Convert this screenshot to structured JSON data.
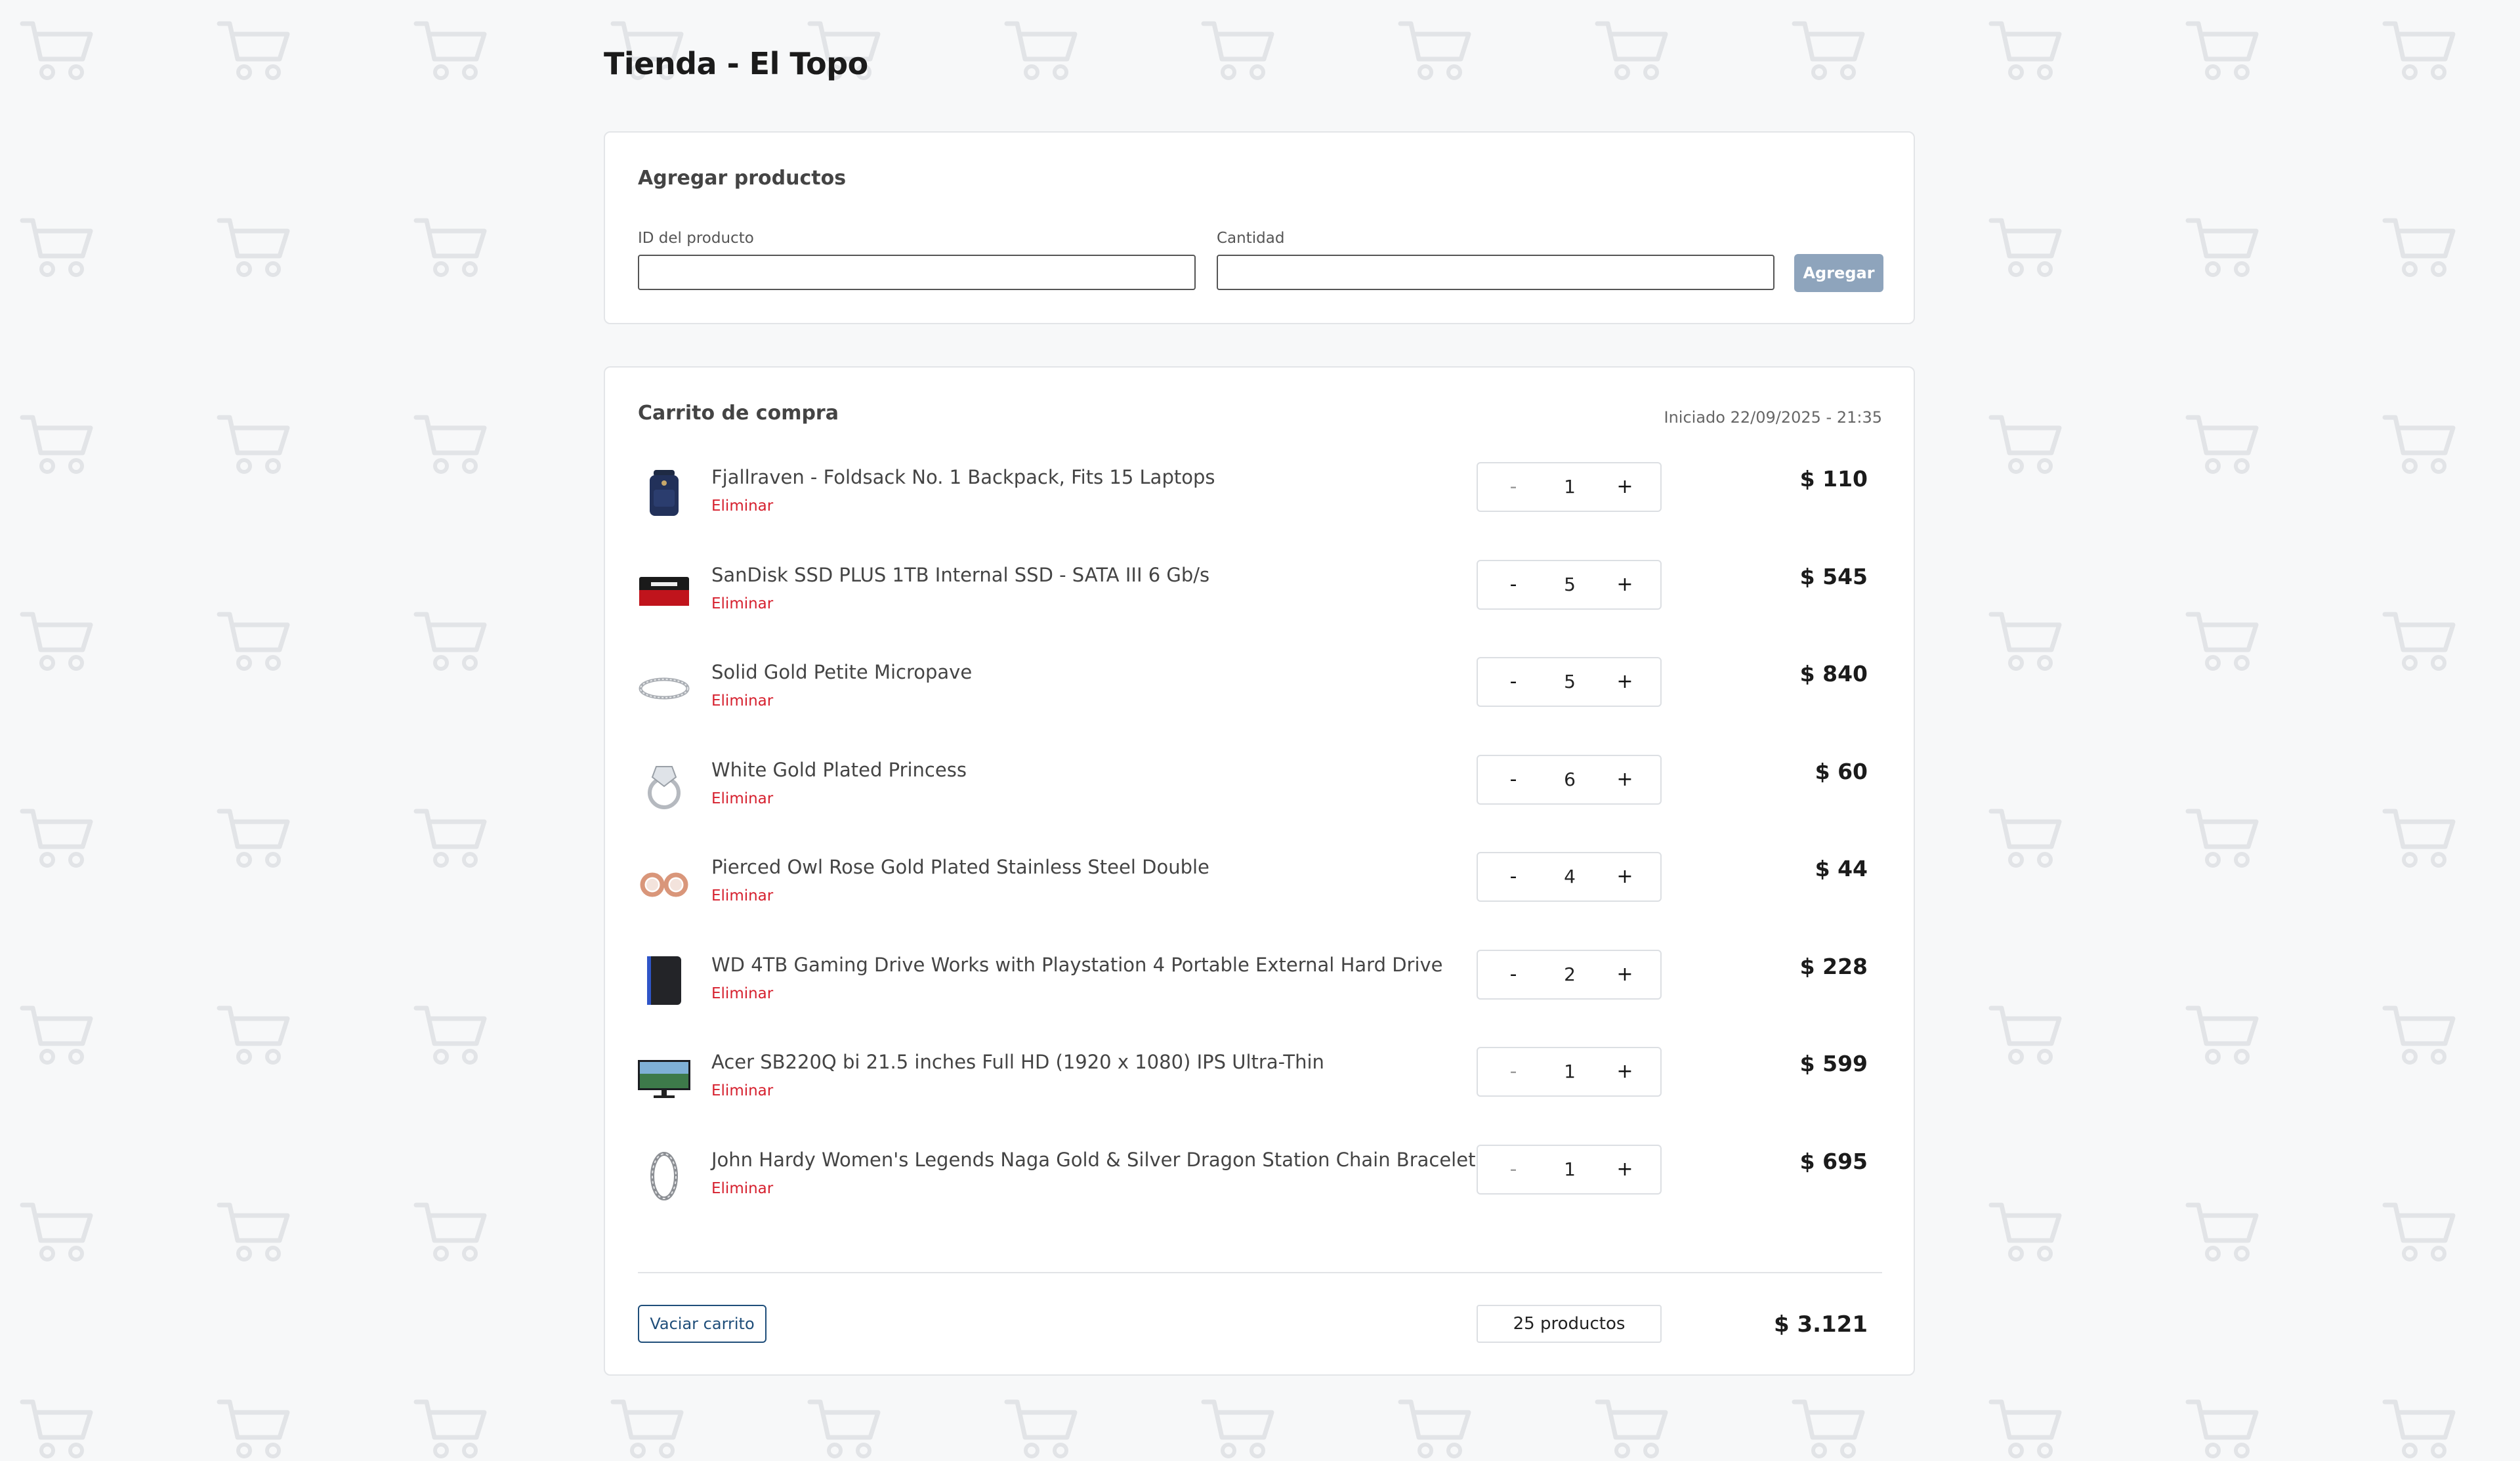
{
  "background": {
    "pattern_icon": "shopping-cart-icon",
    "pattern_color": "#e2e4e7"
  },
  "header": {
    "title": "Tienda - El Topo"
  },
  "add_products": {
    "title": "Agregar productos",
    "product_id_label": "ID del producto",
    "product_id_value": "",
    "quantity_label": "Cantidad",
    "quantity_value": "",
    "submit_label": "Agregar"
  },
  "cart": {
    "title": "Carrito de compra",
    "started": "Iniciado 22/09/2025 - 21:35",
    "remove_label": "Eliminar",
    "items": [
      {
        "name": "Fjallraven - Foldsack No. 1 Backpack, Fits 15 Laptops",
        "qty": "1",
        "price": "$ 110",
        "icon": "backpack-icon"
      },
      {
        "name": "SanDisk SSD PLUS 1TB Internal SSD - SATA III 6 Gb/s",
        "qty": "5",
        "price": "$ 545",
        "icon": "ssd-icon"
      },
      {
        "name": "Solid Gold Petite Micropave",
        "qty": "5",
        "price": "$ 840",
        "icon": "bracelet-icon"
      },
      {
        "name": "White Gold Plated Princess",
        "qty": "6",
        "price": "$ 60",
        "icon": "ring-icon"
      },
      {
        "name": "Pierced Owl Rose Gold Plated Stainless Steel Double",
        "qty": "4",
        "price": "$ 44",
        "icon": "earrings-icon"
      },
      {
        "name": "WD 4TB Gaming Drive Works with Playstation 4 Portable External Hard Drive",
        "qty": "2",
        "price": "$ 228",
        "icon": "hard-drive-icon"
      },
      {
        "name": "Acer SB220Q bi 21.5 inches Full HD (1920 x 1080) IPS Ultra-Thin",
        "qty": "1",
        "price": "$ 599",
        "icon": "monitor-icon"
      },
      {
        "name": "John Hardy Women's Legends Naga Gold & Silver Dragon Station Chain Bracelet",
        "qty": "1",
        "price": "$ 695",
        "icon": "chain-bracelet-icon"
      }
    ],
    "minus_label": "-",
    "plus_label": "+",
    "empty_label": "Vaciar carrito",
    "count_label": "25 productos",
    "total": "$ 3.121"
  },
  "colors": {
    "remove": "#d6202e",
    "add_button": "#8ea4bc",
    "empty_button": "#1f4e7a"
  }
}
